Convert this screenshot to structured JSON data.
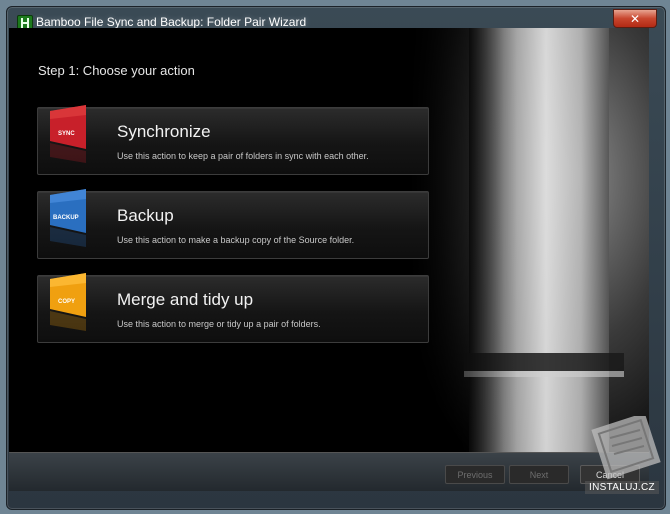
{
  "window": {
    "title": "Bamboo File Sync and Backup: Folder Pair Wizard",
    "close_glyph": "✕"
  },
  "wizard": {
    "step_label": "Step 1:   Choose your action",
    "actions": [
      {
        "title": "Synchronize",
        "description": "Use this action to keep a pair of folders in sync with each other.",
        "badge": "SYNC",
        "color": "#c8202a",
        "icon": "sync-badge-icon"
      },
      {
        "title": "Backup",
        "description": "Use this action to make a backup copy of the Source folder.",
        "badge": "BACKUP",
        "color": "#2a6fc0",
        "icon": "backup-badge-icon"
      },
      {
        "title": "Merge and tidy up",
        "description": "Use this action to merge or tidy up a pair of folders.",
        "badge": "COPY",
        "color": "#f0a010",
        "icon": "copy-badge-icon"
      }
    ]
  },
  "footer": {
    "previous_label": "Previous",
    "next_label": "Next",
    "cancel_label": "Cancel"
  },
  "watermark": {
    "text": "INSTALUJ.CZ"
  }
}
